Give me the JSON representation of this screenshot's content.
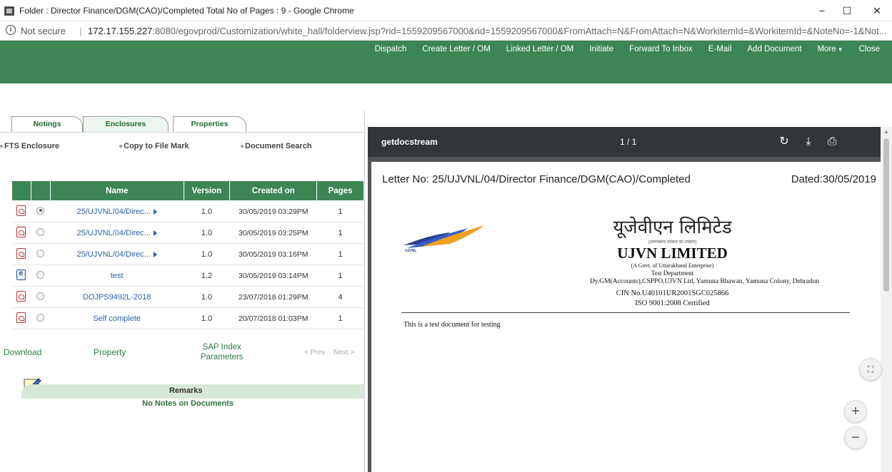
{
  "window": {
    "title": "Folder : Director Finance/DGM(CAO)/Completed Total No of Pages : 9 - Google Chrome",
    "minimize": "−",
    "maximize": "☐",
    "close": "✕"
  },
  "address": {
    "security": "Not secure",
    "host": "172.17.155.227",
    "path": ":8080/egovprod/Customization/white_hall/folderview.jsp?rid=1559209567000&rid=1559209567000&FromAttach=N&FromAttach=N&WorkitemId=&WorkitemId=&NoteNo=-1&Not..."
  },
  "topnav": {
    "items": [
      "Dispatch",
      "Create Letter / OM",
      "Linked Letter / OM",
      "Initiate",
      "Forward To Inbox",
      "E-Mail",
      "Add Document",
      "More",
      "Close"
    ]
  },
  "tabs": [
    "Notings",
    "Enclosures",
    "Properties"
  ],
  "links": {
    "fts": "FTS Enclosure",
    "copy": "Copy to File Mark",
    "search": "Document Search"
  },
  "table": {
    "headers": {
      "name": "Name",
      "version": "Version",
      "created": "Created on",
      "pages": "Pages"
    },
    "rows": [
      {
        "icon": "pdf-icon",
        "selected": true,
        "name": "25/UJVNL/04/Direc...",
        "has_arrow": true,
        "version": "1.0",
        "created": "30/05/2019 03:29PM",
        "pages": "1"
      },
      {
        "icon": "pdf-icon",
        "selected": false,
        "name": "25/UJVNL/04/Direc...",
        "has_arrow": true,
        "version": "1.0",
        "created": "30/05/2019 03:25PM",
        "pages": "1"
      },
      {
        "icon": "pdf-icon",
        "selected": false,
        "name": "25/UJVNL/04/Direc...",
        "has_arrow": true,
        "version": "1.0",
        "created": "30/05/2019 03:16PM",
        "pages": "1"
      },
      {
        "icon": "doc-icon",
        "selected": false,
        "name": "test",
        "has_arrow": false,
        "version": "1.2",
        "created": "30/05/2019 03:14PM",
        "pages": "1"
      },
      {
        "icon": "pdf-icon",
        "selected": false,
        "name": "DOJPS9492L-2018",
        "has_arrow": false,
        "version": "1.0",
        "created": "23/07/2018 01:29PM",
        "pages": "4"
      },
      {
        "icon": "pdf-icon",
        "selected": false,
        "name": "Self complete",
        "has_arrow": false,
        "version": "1.0",
        "created": "20/07/2018 01:03PM",
        "pages": "1"
      }
    ]
  },
  "actions": {
    "download": "Download",
    "property": "Property",
    "sap_line1": "SAP Index",
    "sap_line2": "Parameters",
    "prev": "< Prev",
    "next": "Next >"
  },
  "remarks": {
    "label": "Remarks",
    "empty": "No Notes on Documents"
  },
  "viewer": {
    "docname": "getdocstream",
    "pages": "1 / 1",
    "letter_no": "Letter No: 25/UJVNL/04/Director Finance/DGM(CAO)/Completed",
    "dated": "Dated:30/05/2019",
    "hindi_name": "यूजेवीएन लिमिटेड",
    "hindi_sub": "(उत्तराखण्ड सरकार का उपक्रम)",
    "company": "UJVN LIMITED",
    "govt": "(A Govt. of Uttarakhand Enterprise)",
    "dept": "Test Department",
    "address": "Dy.GM(Accounts),CSPPO,UJVN Ltd, Yamuna Bhawan, Yamuna Colony, Dehradun",
    "cin": "CIN No.U40101UR2001SGC025866",
    "iso": "ISO 9001:2008 Certified",
    "body": "This is a test document for testing",
    "logo_text": "UJVNL"
  }
}
